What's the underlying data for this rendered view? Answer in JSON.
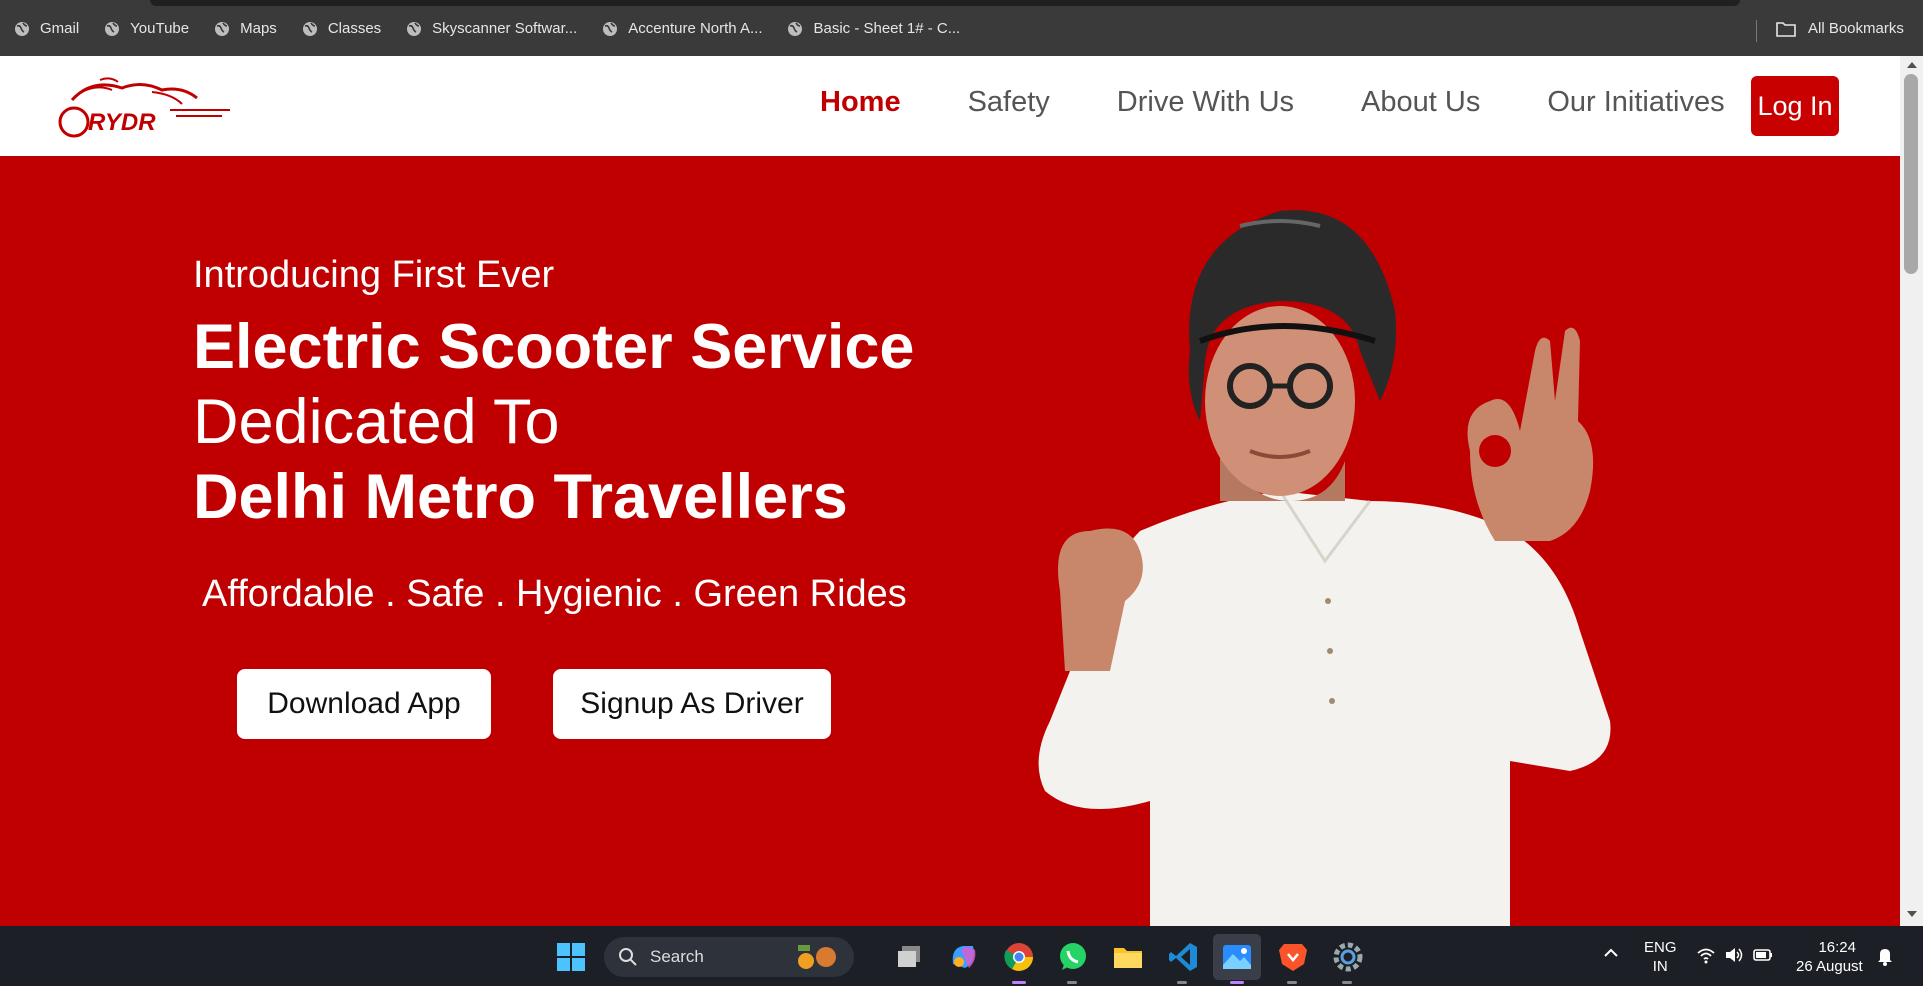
{
  "bookmarks": {
    "items": [
      {
        "label": "Gmail"
      },
      {
        "label": "YouTube"
      },
      {
        "label": "Maps"
      },
      {
        "label": "Classes"
      },
      {
        "label": "Skyscanner Softwar..."
      },
      {
        "label": "Accenture North A..."
      },
      {
        "label": "Basic - Sheet 1# - C..."
      }
    ],
    "all_bookmarks": "All Bookmarks"
  },
  "header": {
    "logo_text": "RYDR",
    "nav": [
      {
        "label": "Home",
        "active": true
      },
      {
        "label": "Safety"
      },
      {
        "label": "Drive With Us"
      },
      {
        "label": "About Us"
      },
      {
        "label": "Our Initiatives"
      }
    ],
    "login_label": "Log In"
  },
  "hero": {
    "intro": "Introducing First Ever",
    "line1": "Electric Scooter Service",
    "line2": "Dedicated To",
    "line3": "Delhi Metro Travellers",
    "tagline": "Affordable . Safe . Hygienic . Green Rides",
    "download_label": "Download App",
    "signup_label": "Signup As Driver"
  },
  "taskbar": {
    "search_label": "Search",
    "lang_line1": "ENG",
    "lang_line2": "IN",
    "time": "16:24",
    "date": "26 August",
    "apps": [
      "windows-start-icon",
      "task-view-icon",
      "copilot-icon",
      "chrome-icon",
      "whatsapp-icon",
      "file-explorer-icon",
      "vscode-icon",
      "photos-icon",
      "brave-icon",
      "settings-icon"
    ]
  },
  "colors": {
    "brand_red": "#c00000",
    "nav_text": "#555555",
    "bookmarks_bg": "#3a3a3a",
    "taskbar_bg": "#1c1f26"
  }
}
